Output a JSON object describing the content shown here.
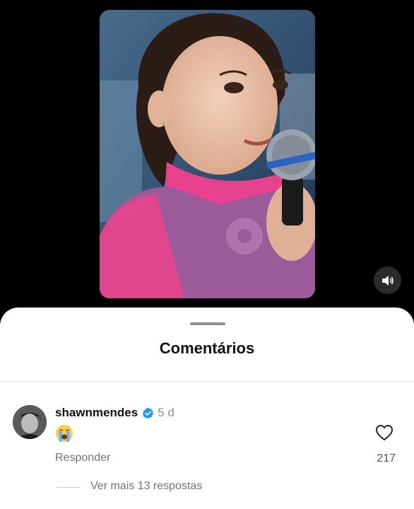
{
  "video": {
    "image_description": "Girl in pink turtleneck and purple vest holding a microphone",
    "muted": false
  },
  "icons": {
    "volume": "volume-icon",
    "verified": "verified-badge-icon",
    "like": "heart-icon",
    "emoji": "crying-face-emoji"
  },
  "sheet": {
    "title": "Comentários"
  },
  "comment": {
    "username": "shawnmendes",
    "verified": true,
    "time_ago": "5 d",
    "text_emoji": "😭",
    "reply_label": "Responder",
    "like_count": "217",
    "view_replies_label": "Ver mais 13 respostas"
  },
  "colors": {
    "verified_blue": "#1d9bf0",
    "sheet_background": "#ffffff",
    "secondary_text": "#737373"
  }
}
